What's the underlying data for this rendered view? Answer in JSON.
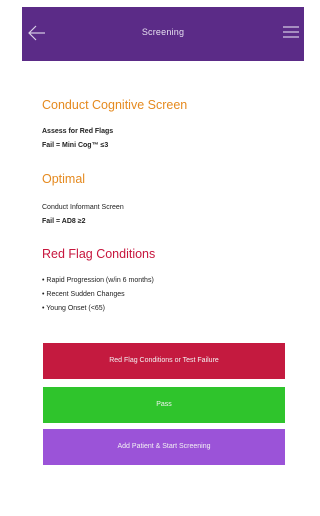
{
  "header": {
    "title": "Screening",
    "back_icon": "arrow-left-icon",
    "menu_icon": "hamburger-menu-icon",
    "background_color": "#5b2b87"
  },
  "sections": {
    "cognitive": {
      "heading": "Conduct Cognitive Screen",
      "line1": "Assess for Red Flags",
      "line2": "Fail = Mini Cog™ ≤3"
    },
    "optimal": {
      "heading": "Optimal",
      "line1": "Conduct Informant Screen",
      "line2": "Fail = AD8 ≥2"
    },
    "red_flags": {
      "heading": "Red Flag Conditions",
      "items": [
        "• Rapid Progression (w/in 6 months)",
        "• Recent Sudden Changes",
        "• Young Onset (<65)"
      ]
    }
  },
  "buttons": {
    "red_flag": "Red Flag Conditions or Test Failure",
    "pass": "Pass",
    "add_patient": "Add Patient & Start Screening"
  },
  "colors": {
    "orange": "#e58a1f",
    "red": "#c7163d",
    "red_button": "#c41a3f",
    "green_button": "#2fc42c",
    "purple_button": "#9b53d8"
  }
}
